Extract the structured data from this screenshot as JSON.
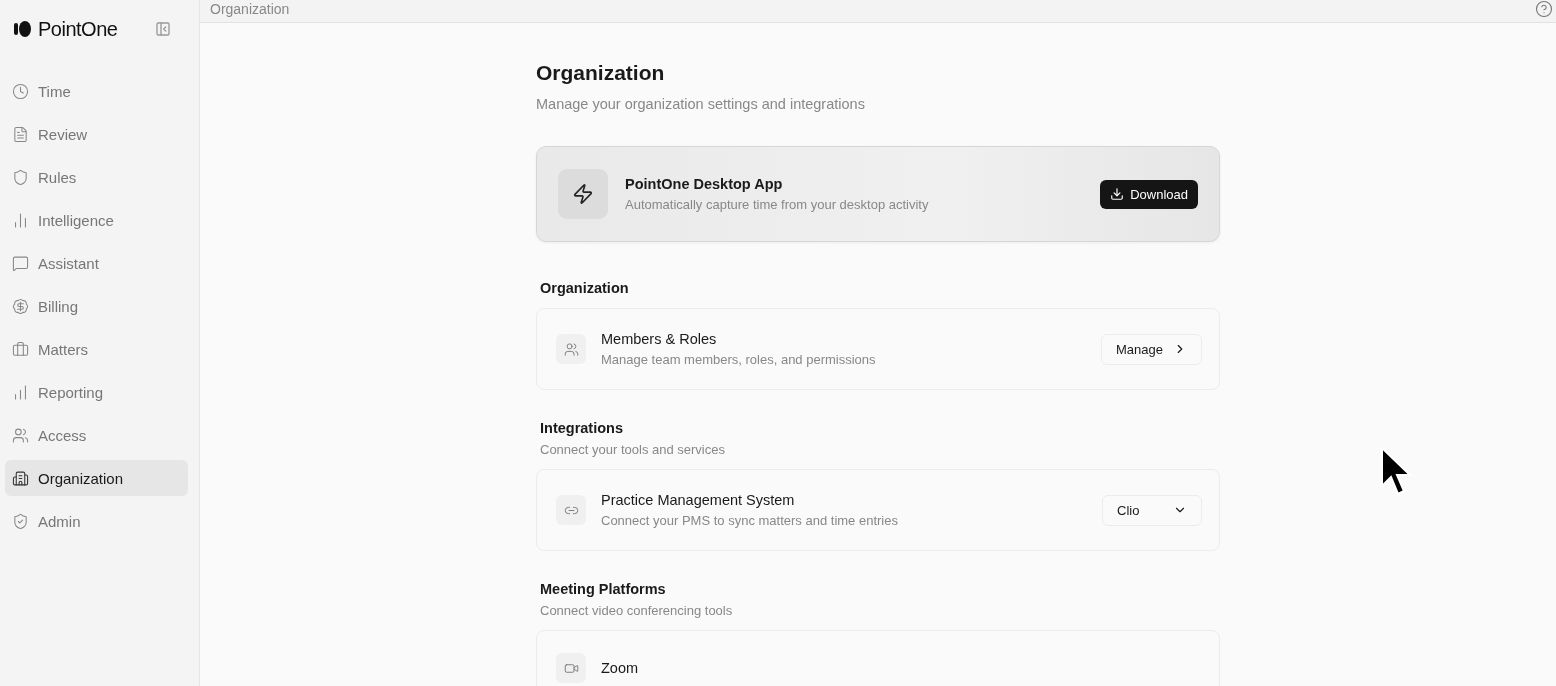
{
  "sidebar": {
    "brand": "PointOne",
    "items": [
      {
        "label": "Time",
        "selected": false
      },
      {
        "label": "Review",
        "selected": false
      },
      {
        "label": "Rules",
        "selected": false
      },
      {
        "label": "Intelligence",
        "selected": false
      },
      {
        "label": "Assistant",
        "selected": false
      },
      {
        "label": "Billing",
        "selected": false
      },
      {
        "label": "Matters",
        "selected": false
      },
      {
        "label": "Reporting",
        "selected": false
      },
      {
        "label": "Access",
        "selected": false
      },
      {
        "label": "Organization",
        "selected": true
      },
      {
        "label": "Admin",
        "selected": false
      }
    ]
  },
  "topbar": {
    "breadcrumb": "Organization"
  },
  "page": {
    "title": "Organization",
    "subtitle": "Manage your organization settings and integrations"
  },
  "promo": {
    "title": "PointOne Desktop App",
    "description": "Automatically capture time from your desktop activity",
    "button": "Download"
  },
  "sections": [
    {
      "title": "Organization",
      "cards": [
        {
          "title": "Members & Roles",
          "description": "Manage team members, roles, and permissions",
          "control": {
            "kind": "button",
            "label": "Manage"
          }
        }
      ]
    },
    {
      "title": "Integrations",
      "subtitle": "Connect your tools and services",
      "cards": [
        {
          "title": "Practice Management System",
          "description": "Connect your PMS to sync matters and time entries",
          "control": {
            "kind": "select",
            "label": "Clio"
          }
        }
      ]
    },
    {
      "title": "Meeting Platforms",
      "subtitle": "Connect video conferencing tools",
      "cards": [
        {
          "title": "Zoom"
        }
      ]
    }
  ]
}
